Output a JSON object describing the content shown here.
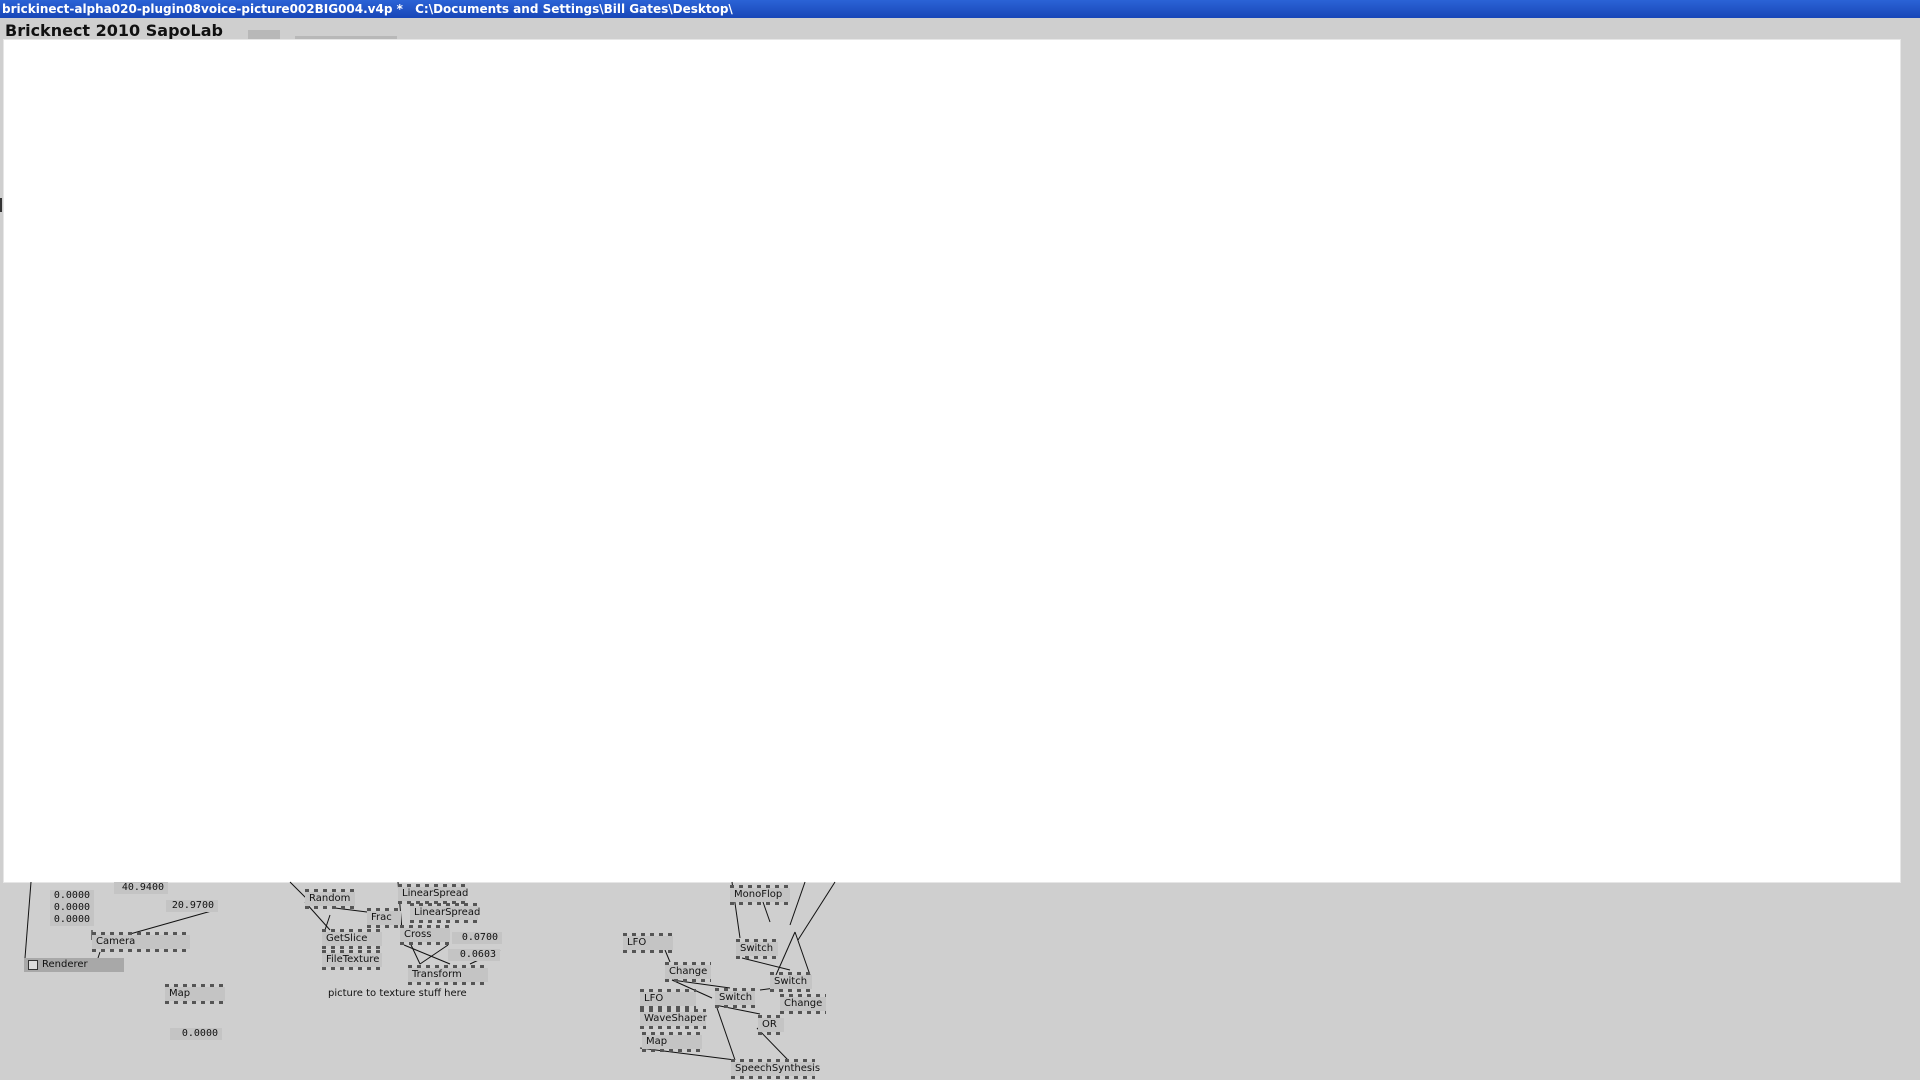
{
  "window": {
    "filename": "brickinect-alpha020-plugin08voice-picture002BIG004.v4p *",
    "path": "C:\\Documents and Settings\\Bill Gates\\Desktop\\"
  },
  "patch": {
    "title": "Bricknect 2010 SapoLab"
  },
  "nodes": {
    "renderer": "Renderer",
    "camera": "Camera",
    "map1": "Map",
    "random": "Random",
    "frac": "Frac",
    "getslice": "GetSlice",
    "filetexture": "FileTexture",
    "linearspread1": "LinearSpread",
    "linearspread2": "LinearSpread",
    "cross": "Cross",
    "transform": "Transform",
    "lfo1": "LFO",
    "lfo2": "LFO",
    "change1": "Change",
    "change2": "Change",
    "waveshaper": "WaveShaper",
    "map2": "Map",
    "monoflop": "MonoFlop",
    "switch1": "Switch",
    "switch2": "Switch",
    "switch3": "Switch",
    "or": "OR",
    "speechsynthesis": "SpeechSynthesis"
  },
  "values": {
    "v_40_94": "40.9400",
    "v_x": "0.0000",
    "v_y": "0.0000",
    "v_z": "0.0000",
    "v_20_97": "20.9700",
    "v_map_out": "0.0000",
    "v_0_07": "0.0700",
    "v_0_0603": "0.0603"
  },
  "comments": {
    "texture_note": "picture to texture stuff here"
  }
}
